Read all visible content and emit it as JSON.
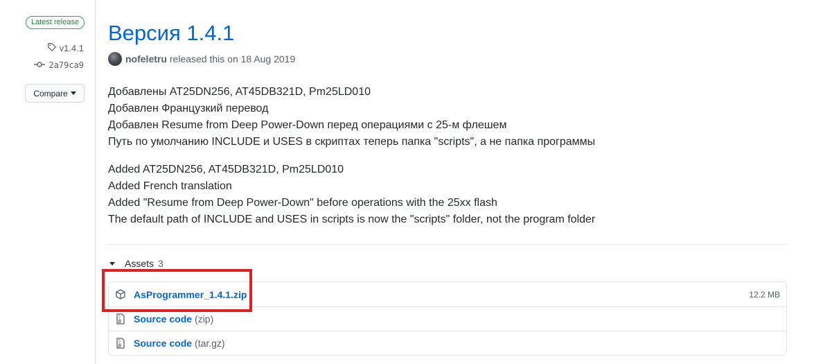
{
  "sidebar": {
    "badge": "Latest release",
    "tag": "v1.4.1",
    "commit": "2a79ca9",
    "compare_label": "Compare"
  },
  "release": {
    "title": "Версия 1.4.1",
    "author": "nofeletru",
    "released_text": "released this on 18 Aug 2019"
  },
  "notes": {
    "ru": [
      "Добавлены AT25DN256, AT45DB321D, Pm25LD010",
      "Добавлен Французкий перевод",
      "Добавлен Resume from Deep Power-Down перед операциями с 25-м флешем",
      "Путь по умолчанию INCLUDE и USES в скриптах теперь папка \"scripts\", а не папка программы"
    ],
    "en": [
      "Added AT25DN256, AT45DB321D, Pm25LD010",
      "Added French translation",
      "Added \"Resume from Deep Power-Down\" before operations with the 25xx flash",
      "The default path of INCLUDE and USES in scripts is now the \"scripts\" folder, not the program folder"
    ]
  },
  "assets": {
    "label": "Assets",
    "count": "3",
    "items": [
      {
        "name": "AsProgrammer_1.4.1.zip",
        "ext": "",
        "size": "12.2 MB",
        "icon": "package-icon"
      },
      {
        "name": "Source code",
        "ext": "(zip)",
        "size": "",
        "icon": "file-zip-icon"
      },
      {
        "name": "Source code",
        "ext": "(tar.gz)",
        "size": "",
        "icon": "file-zip-icon"
      }
    ]
  },
  "colors": {
    "link": "#0366d6",
    "badge_green": "#28a745",
    "highlight_red": "#e02020"
  }
}
